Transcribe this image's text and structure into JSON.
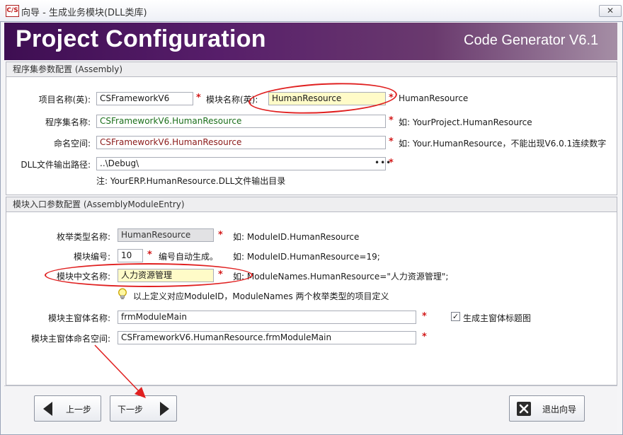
{
  "window": {
    "title": "向导 - 生成业务模块(DLL类库)",
    "app_icon_text": "C/S",
    "close_symbol": "✕"
  },
  "banner": {
    "title": "Project Configuration",
    "subtitle": "Code Generator V6.1"
  },
  "assembly_group": {
    "heading": "程序集参数配置 (Assembly)",
    "project_name_label": "项目名称(英):",
    "project_name_value": "CSFrameworkV6",
    "module_name_label": "模块名称(英):",
    "module_name_value": "HumanResource",
    "module_name_hint": "HumanResource",
    "assembly_name_label": "程序集名称:",
    "assembly_name_value": "CSFrameworkV6.HumanResource",
    "assembly_name_hint": "如: YourProject.HumanResource",
    "namespace_label": "命名空间:",
    "namespace_value": "CSFrameworkV6.HumanResource",
    "namespace_hint": "如: Your.HumanResource，不能出现V6.0.1连续数字",
    "output_path_label": "DLL文件输出路径:",
    "output_path_value": "..\\Debug\\",
    "browse_dots": "•••",
    "output_note": "注: YourERP.HumanResource.DLL文件输出目录"
  },
  "entry_group": {
    "heading": "模块入口参数配置 (AssemblyModuleEntry)",
    "enum_type_label": "枚举类型名称:",
    "enum_type_value": "HumanResource",
    "enum_type_hint": "如: ModuleID.HumanResource",
    "module_no_label": "模块编号:",
    "module_no_value": "10",
    "module_no_auto": "编号自动生成。",
    "module_no_hint": "如: ModuleID.HumanResource=19;",
    "cn_name_label": "模块中文名称:",
    "cn_name_value": "人力资源管理",
    "cn_name_hint": "如: ModuleNames.HumanResource=\"人力资源管理\";",
    "info_text": "以上定义对应ModuleID，ModuleNames  两个枚举类型的项目定义",
    "main_form_label": "模块主窗体名称:",
    "main_form_value": "frmModuleMain",
    "gen_title_checked": true,
    "gen_title_label": "生成主窗体标题图",
    "main_form_ns_label": "模块主窗体命名空间:",
    "main_form_ns_value": "CSFrameworkV6.HumanResource.frmModuleMain"
  },
  "required_mark": "*",
  "buttons": {
    "prev": "上一步",
    "next": "下一步",
    "exit": "退出向导"
  },
  "colors": {
    "banner": "#4a1560",
    "required": "#d31a1a",
    "highlight_field": "#fffbc8",
    "annotation": "#e02020"
  }
}
